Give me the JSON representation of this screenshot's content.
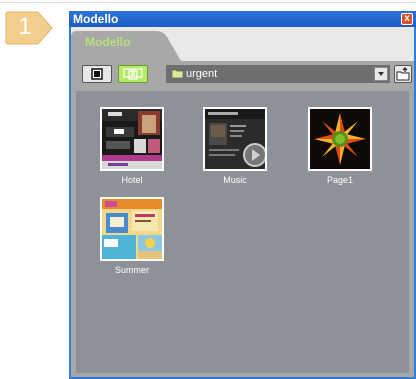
{
  "step": {
    "number": "1"
  },
  "window": {
    "title": "Modello",
    "tab_label": "Modello",
    "close_glyph": "x"
  },
  "toolbar": {
    "folder_name": "urgent"
  },
  "templates": [
    {
      "name": "Hotel"
    },
    {
      "name": "Music"
    },
    {
      "name": "Page1"
    },
    {
      "name": "Summer"
    }
  ],
  "colors": {
    "titlebar": "#1f63c8",
    "tab_text": "#b7e07a",
    "active_button": "#b8ea6a",
    "grid_background": "#8e9197"
  }
}
